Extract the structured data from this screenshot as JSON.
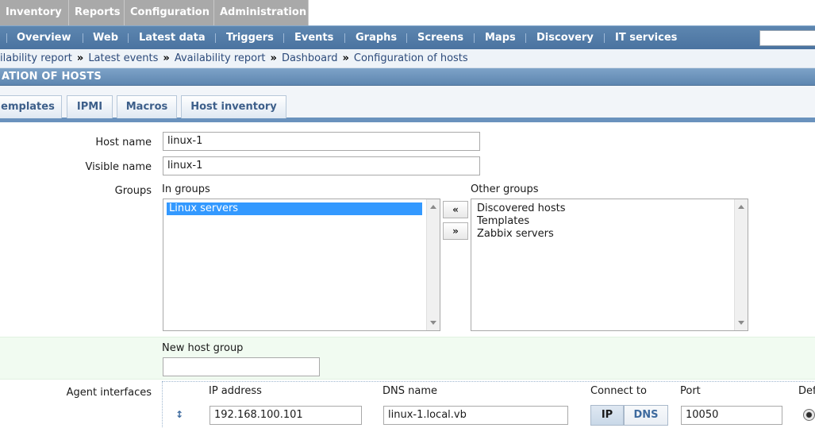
{
  "top_menu": {
    "items": [
      "Inventory",
      "Reports",
      "Configuration",
      "Administration"
    ]
  },
  "main_nav": {
    "items": [
      "Overview",
      "Web",
      "Latest data",
      "Triggers",
      "Events",
      "Graphs",
      "Screens",
      "Maps",
      "Discovery",
      "IT services"
    ]
  },
  "breadcrumb": {
    "items": [
      "ilability report",
      "Latest events",
      "Availability report",
      "Dashboard",
      "Configuration of hosts"
    ],
    "separator": "»"
  },
  "page_title": "ATION OF HOSTS",
  "tabs": [
    "emplates",
    "IPMI",
    "Macros",
    "Host inventory"
  ],
  "form": {
    "host_name_label": "Host name",
    "host_name_value": "linux-1",
    "visible_name_label": "Visible name",
    "visible_name_value": "linux-1",
    "groups_label": "Groups",
    "in_groups_label": "In groups",
    "in_groups": [
      "Linux servers"
    ],
    "other_groups_label": "Other groups",
    "other_groups": [
      "Discovered hosts",
      "Templates",
      "Zabbix servers"
    ],
    "add_button": "«",
    "remove_button": "»",
    "new_host_group_label": "New host group",
    "new_host_group_value": "",
    "agent_interfaces_label": "Agent interfaces",
    "interfaces": {
      "col_ip": "IP address",
      "col_dns": "DNS name",
      "col_connect": "Connect to",
      "col_port": "Port",
      "col_default": "Def",
      "ip_value": "192.168.100.101",
      "dns_value": "linux-1.local.vb",
      "connect_ip": "IP",
      "connect_dns": "DNS",
      "port_value": "10050"
    }
  },
  "colors": {
    "nav_blue": "#5d86b0",
    "link": "#2c4a7a",
    "selected": "#3399ff",
    "new_group_bg": "#f1fbf1"
  }
}
